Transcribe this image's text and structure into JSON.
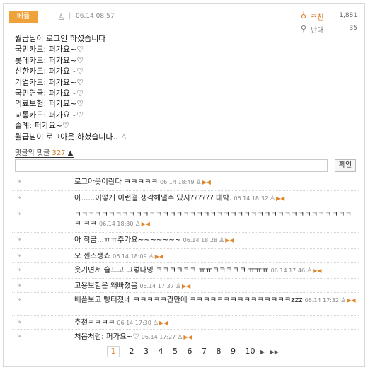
{
  "post": {
    "badge": "베플",
    "user_icon": "user-icon",
    "separator": "|",
    "time": "06.14 08:57",
    "votes": {
      "up_icon": "thumbs-up-icon",
      "up_label": "추천",
      "up_count": "1,881",
      "down_icon": "thumbs-down-icon",
      "down_label": "반대",
      "down_count": "35"
    },
    "lines": [
      "월급님이 로그인 하셨습니다",
      "국민카드: 퍼가요~♡",
      "롯데카드: 퍼가요~♡",
      "신한카드: 퍼가요~♡",
      "기업카드: 퍼가요~♡",
      "국민연금: 퍼가요~♡",
      "의료보험: 퍼가요~♡",
      "교통카드: 퍼가요~♡",
      "졸례: 퍼가요~♡",
      "월급님이 로그아웃 하셨습니다.."
    ]
  },
  "replies": {
    "toggle_label": "댓글의 댓글",
    "toggle_count": "327",
    "toggle_arrow": "▲",
    "input_placeholder": "",
    "submit_label": "확인"
  },
  "comments": [
    {
      "text": "로그아웃이란다 ㅋㅋㅋㅋㅋ",
      "time": "06.14 18:49"
    },
    {
      "text": "아......어떻게 이런걸 생각해낼수 있지?????? 대박.",
      "time": "06.14 18:32"
    },
    {
      "text": "ㅋㅋㅋㅋㅋㅋㅋㅋㅋㅋㅋㅋㅋㅋㅋㅋㅋㅋㅋㅋㅋㅋㅋㅋㅋㅋㅋㅋㅋㅋㅋㅋㅋㅋㅋㅋㅋㅋㅋㅋㅋㅋ ㅋㅋ",
      "time": "06.14 18:30"
    },
    {
      "text": "아 적금...ㅠㅠ추가요~~~~~~~",
      "time": "06.14 18:28"
    },
    {
      "text": "오 센스쟁쇼",
      "time": "06.14 18:09"
    },
    {
      "text": "웃기면서 슬프고 그렇다잉 ㅋㅋㅋㅋㅋㅋ ㅠㅠㅋㅋㅋㅋㅋ ㅠㅠㅠ",
      "time": "06.14 17:46"
    },
    {
      "text": "고용보험은 왜빠졌음",
      "time": "06.14 17:37"
    },
    {
      "text": "베플보고 빵터졌네 ㅋㅋㅋㅋㅋ간만에 ㅋㅋㅋㅋㅋㅋㅋㅋㅋㅋㅋㅋㅋㅋㅋzzz",
      "time": "06.14 17:32"
    },
    {
      "text": "추천ㅋㅋㅋㅋ",
      "time": "06.14 17:30"
    },
    {
      "text": "처음처럼: 퍼가요~♡",
      "time": "06.14 17:27"
    }
  ],
  "pagination": {
    "pages": [
      "1",
      "2",
      "3",
      "4",
      "5",
      "6",
      "7",
      "8",
      "9",
      "10"
    ],
    "current": "1",
    "next_label": "▶",
    "last_label": "▶▶"
  },
  "colors": {
    "accent": "#e2842a",
    "badge": "#f0a23a"
  }
}
